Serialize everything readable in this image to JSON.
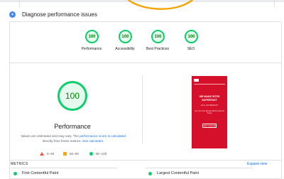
{
  "diagnose": {
    "title": "Diagnose performance issues"
  },
  "categories": [
    {
      "score": "100",
      "label": "Performance"
    },
    {
      "score": "100",
      "label": "Accessibility"
    },
    {
      "score": "100",
      "label": "Best Practices"
    },
    {
      "score": "100",
      "label": "SEO"
    }
  ],
  "performance": {
    "score": "100",
    "title": "Performance",
    "note_prefix": "Values are estimated and may vary. The",
    "note_link1": "performance score is calculated",
    "note_middle": "directly from these metrics.",
    "note_link2": "See calculator."
  },
  "legend": [
    {
      "label": "0–49",
      "color": "#ff4e42"
    },
    {
      "label": "50–89",
      "color": "#ffa400"
    },
    {
      "label": "90–100",
      "color": "#0cce6b"
    }
  ],
  "screenshot": {
    "heading": "WE MAKE SITES SUPERFAST",
    "subtitle": "Score 100 PERFECTO",
    "body": "Get Your Own Website Built by Experts Today!",
    "button": "GET A QUOTE"
  },
  "metrics": {
    "label": "METRICS",
    "expand": "Expand view",
    "items": [
      {
        "label": "First Contentful Paint"
      },
      {
        "label": "Largest Contentful Paint"
      }
    ]
  },
  "colors": {
    "good": "#0cce6b",
    "average": "#ffa400",
    "fail": "#ff4e42",
    "accent": "#1a73e8",
    "screenshot_bg": "#d5102a"
  }
}
